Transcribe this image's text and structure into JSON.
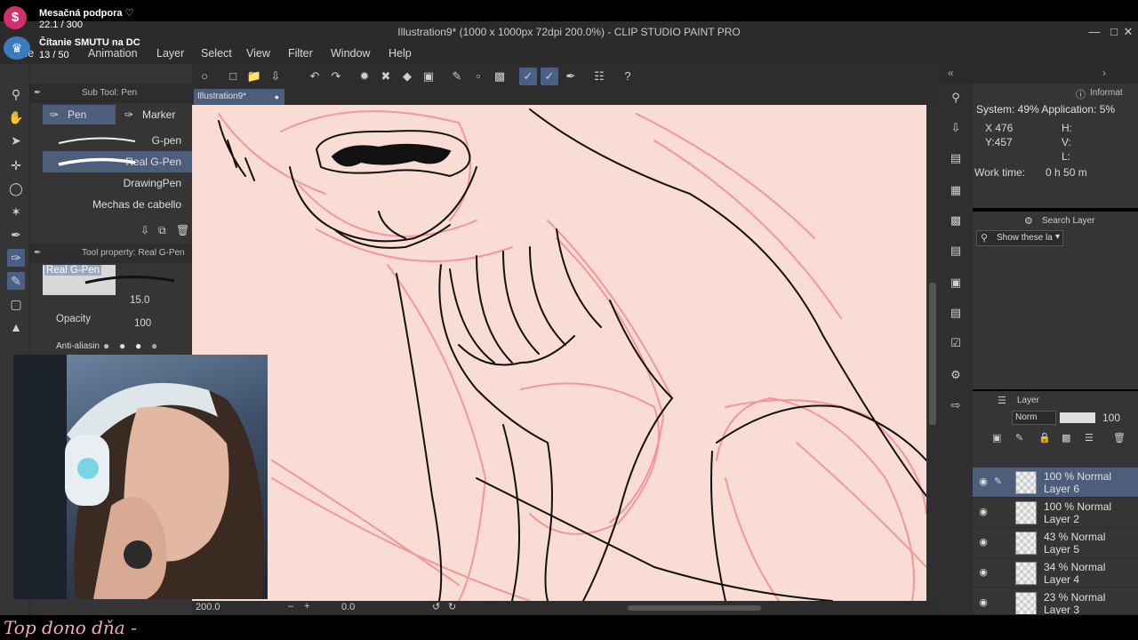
{
  "window": {
    "title": "Illustration9* (1000 x 1000px 72dpi 200.0%)  - CLIP STUDIO PAINT PRO",
    "minimize_icon": "minimize-icon",
    "maximize_icon": "maximize-icon",
    "close_icon": "close-icon"
  },
  "menu": [
    {
      "label": "File"
    },
    {
      "label": "Animation"
    },
    {
      "label": "Layer"
    },
    {
      "label": "Select"
    },
    {
      "label": "View"
    },
    {
      "label": "Filter"
    },
    {
      "label": "Window"
    },
    {
      "label": "Help"
    }
  ],
  "overlay": {
    "support_title": "Mesačná podpora ♡",
    "support_count": "22.1 / 300",
    "goal_title": "Čítanie SMUTU na DC",
    "goal_count": "13 / 50",
    "bottom_text": "Top dono dňa -",
    "accent": "#d1306e"
  },
  "subtool": {
    "header": "Sub Tool: Pen",
    "tabs": [
      {
        "label": "Pen"
      },
      {
        "label": "Marker"
      }
    ],
    "brushes": [
      {
        "label": "G-pen"
      },
      {
        "label": "Real G-Pen"
      },
      {
        "label": "DrawingPen"
      },
      {
        "label": "Mechas de cabello"
      }
    ]
  },
  "tool_property": {
    "header": "Tool property: Real G-Pen",
    "brush_name": "Real G-Pen",
    "size_value": "15.0",
    "opacity_label": "Opacity",
    "opacity_value": "100",
    "antialias_label": "Anti-aliasin"
  },
  "document": {
    "tab_label": "Illustration9*",
    "zoom_value": "200.0",
    "angle_value": "0.0",
    "canvas_color": "#f9dcd3"
  },
  "info": {
    "header": "Informat",
    "system": "System: 49% Application:  5%",
    "x": "X  476",
    "y": "Y:457",
    "h": "H:",
    "v": "V:",
    "l": "L:",
    "work_time_label": "Work time:",
    "work_time_value": "0 h 50 m"
  },
  "search": {
    "header": "Search Layer",
    "filter_label": "Show these la"
  },
  "layers": {
    "header": "Layer",
    "blend_mode": "Norm",
    "opacity": "100",
    "items": [
      {
        "mode": "100 % Normal",
        "name": "Layer 6",
        "active": true
      },
      {
        "mode": "100 % Normal",
        "name": "Layer 2",
        "active": false
      },
      {
        "mode": "43 % Normal",
        "name": "Layer 5",
        "active": false
      },
      {
        "mode": "34 % Normal",
        "name": "Layer 4",
        "active": false
      },
      {
        "mode": "23 % Normal",
        "name": "Layer 3",
        "active": false
      }
    ],
    "active_color": "#4d5d7c"
  }
}
